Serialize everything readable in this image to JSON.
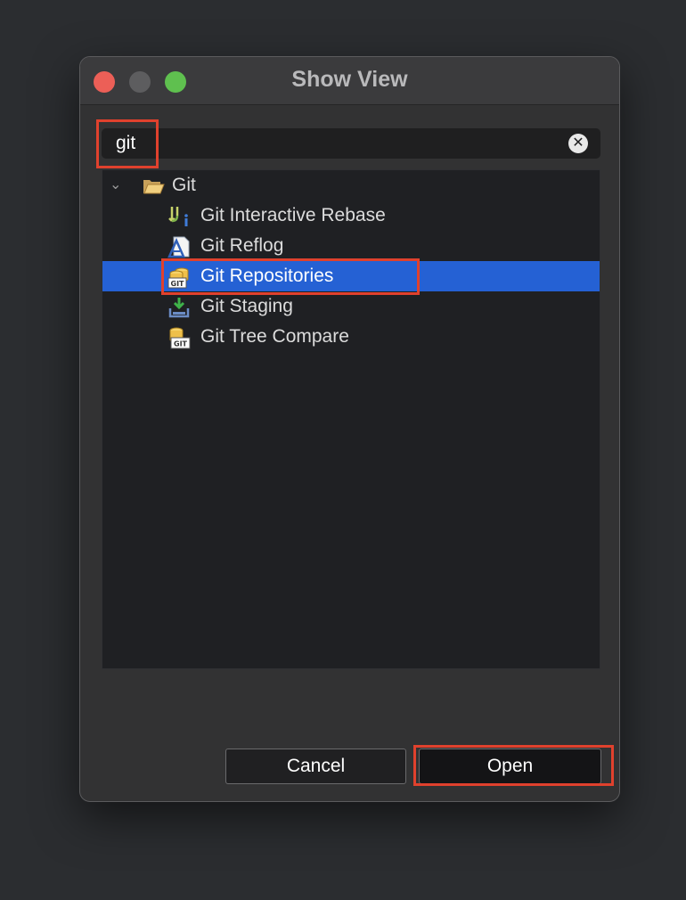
{
  "window": {
    "title": "Show View"
  },
  "search": {
    "value": "git"
  },
  "tree": {
    "group_label": "Git",
    "items": [
      {
        "label": "Git Interactive Rebase"
      },
      {
        "label": "Git Reflog"
      },
      {
        "label": "Git Repositories"
      },
      {
        "label": "Git Staging"
      },
      {
        "label": "Git Tree Compare"
      }
    ],
    "selected_item": "Git Repositories"
  },
  "buttons": {
    "cancel_label": "Cancel",
    "open_label": "Open"
  },
  "colors": {
    "selection": "#2561d4",
    "highlight_box": "#e0412d"
  }
}
